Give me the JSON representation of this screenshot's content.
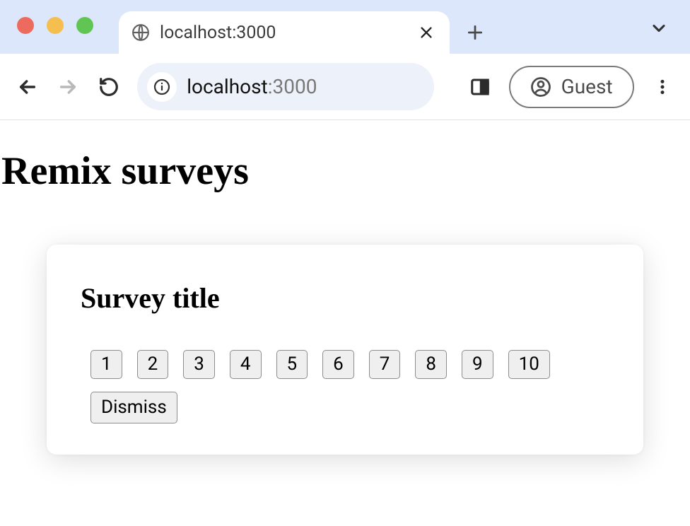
{
  "browser": {
    "tab_title": "localhost:3000",
    "url_host": "localhost",
    "url_port": ":3000",
    "profile_label": "Guest"
  },
  "page": {
    "heading": "Remix surveys"
  },
  "survey": {
    "title": "Survey title",
    "options": [
      "1",
      "2",
      "3",
      "4",
      "5",
      "6",
      "7",
      "8",
      "9",
      "10"
    ],
    "dismiss_label": "Dismiss"
  }
}
